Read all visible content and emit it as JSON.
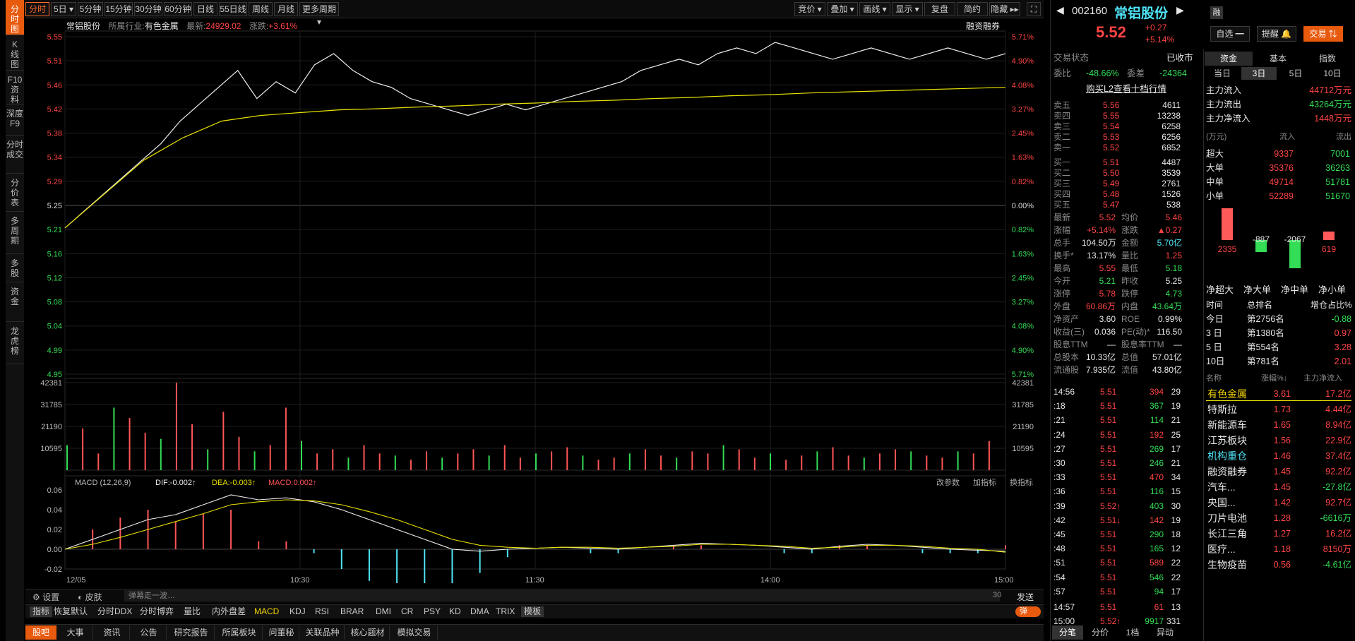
{
  "left_tabs": [
    "分\n时\n图",
    "K\n线\n图",
    "F10\n资\n料",
    "深度\nF9",
    "分时\n成交",
    "分\n价\n表",
    "多\n周\n期",
    "多\n股",
    "资\n金",
    "龙\n虎\n榜"
  ],
  "top_tabs": [
    "分时",
    "5日",
    "5分钟",
    "15分钟",
    "30分钟",
    "60分钟",
    "日线",
    "55日线",
    "周线",
    "月线",
    "更多周期"
  ],
  "top_tools": [
    "竞价",
    "叠加",
    "画线",
    "显示",
    "复盘",
    "简约",
    "隐藏"
  ],
  "chart_header": {
    "name": "常铝股份",
    "industry_label": "所属行业:",
    "industry": "有色金属",
    "latest_label": "最新:",
    "latest": "24929.02",
    "change_label": "涨跌:",
    "change": "+3.61%",
    "rzrq": "融资融券"
  },
  "chart_data": [
    {
      "type": "line",
      "title": "",
      "x_ticks": [
        "12/05",
        "10:30",
        "11:30",
        "14:00",
        "15:00"
      ],
      "ylim": [
        4.95,
        5.55
      ],
      "price_ticks": [
        "5.55",
        "5.51",
        "5.46",
        "5.42",
        "5.38",
        "5.34",
        "5.29",
        "5.25",
        "5.21",
        "5.16",
        "5.12",
        "5.08",
        "5.04",
        "4.99",
        "4.95"
      ],
      "pct_ticks": [
        "5.71%",
        "4.90%",
        "4.08%",
        "3.27%",
        "2.45%",
        "1.63%",
        "0.82%",
        "0.00%",
        "0.82%",
        "1.63%",
        "2.45%",
        "3.27%",
        "4.08%",
        "4.90%",
        "5.71%"
      ],
      "series": [
        {
          "values": [
            5.21,
            5.24,
            5.27,
            5.3,
            5.33,
            5.36,
            5.4,
            5.43,
            5.46,
            5.49,
            5.44,
            5.47,
            5.45,
            5.5,
            5.52,
            5.49,
            5.47,
            5.46,
            5.44,
            5.43,
            5.42,
            5.41,
            5.42,
            5.43,
            5.42,
            5.43,
            5.44,
            5.45,
            5.46,
            5.47,
            5.49,
            5.5,
            5.51,
            5.5,
            5.52,
            5.53,
            5.52,
            5.54,
            5.53,
            5.52,
            5.51,
            5.52,
            5.53,
            5.52,
            5.51,
            5.52,
            5.53,
            5.52,
            5.51,
            5.52
          ]
        },
        {
          "values": [
            5.21,
            5.27,
            5.33,
            5.37,
            5.4,
            5.41,
            5.415,
            5.42,
            5.422,
            5.425,
            5.427,
            5.43,
            5.432,
            5.435,
            5.437,
            5.44,
            5.442,
            5.445,
            5.447,
            5.45,
            5.452,
            5.454,
            5.456,
            5.458,
            5.46
          ]
        }
      ]
    },
    {
      "type": "bar",
      "title": "",
      "yticks": [
        "42381",
        "31785",
        "21190",
        "10595"
      ],
      "values": [
        12,
        20,
        8,
        30,
        25,
        18,
        15,
        42,
        22,
        10,
        28,
        16,
        9,
        12,
        30,
        14,
        8,
        10,
        6,
        12,
        8,
        7,
        5,
        9,
        6,
        8,
        10,
        7,
        12,
        6,
        8,
        9,
        11,
        7,
        5,
        6,
        8,
        10,
        7,
        6,
        9,
        8,
        12,
        10,
        6,
        8,
        5,
        7,
        9,
        11,
        7,
        6,
        8,
        10,
        9,
        7,
        6,
        9,
        8,
        14
      ]
    },
    {
      "type": "line",
      "title": "",
      "name_label": "MACD (12,26,9)",
      "dif": "DIF:-0.002",
      "dea": "DEA:-0.003",
      "macd": "MACD:0.002",
      "yticks": [
        "0.06",
        "0.04",
        "0.02",
        "0.00",
        "-0.02"
      ],
      "ylim": [
        -0.02,
        0.06
      ],
      "series": [
        {
          "values": [
            0.0,
            0.01,
            0.02,
            0.03,
            0.035,
            0.045,
            0.055,
            0.05,
            0.052,
            0.048,
            0.04,
            0.03,
            0.02,
            0.01,
            0.0,
            -0.002,
            0.0,
            0.001,
            0.002,
            0.001,
            0.0,
            0.002,
            0.004,
            0.006,
            0.005,
            0.004,
            0.002,
            0.0,
            0.003,
            0.005,
            0.004,
            0.002,
            0.0,
            -0.001,
            -0.002
          ]
        },
        {
          "values": [
            0.0,
            0.005,
            0.012,
            0.02,
            0.028,
            0.036,
            0.045,
            0.048,
            0.05,
            0.049,
            0.045,
            0.038,
            0.03,
            0.02,
            0.01,
            0.004,
            0.002,
            0.001,
            0.002,
            0.002,
            0.001,
            0.002,
            0.003,
            0.005,
            0.005,
            0.004,
            0.003,
            0.001,
            0.002,
            0.004,
            0.004,
            0.003,
            0.001,
            0.0,
            -0.003
          ]
        }
      ]
    }
  ],
  "macd_tools": [
    "改参数",
    "加指标",
    "换指标"
  ],
  "bottom": {
    "settings": "设置",
    "skin": "皮肤",
    "danmu_placeholder": "弹幕走一波…",
    "count": "30",
    "send": "发送",
    "indicators": [
      "指标",
      "恢复默认",
      "分时DDX",
      "分时博弈",
      "量比",
      "内外盘差",
      "MACD",
      "KDJ",
      "RSI",
      "BRAR",
      "DMI",
      "CR",
      "PSY",
      "KD",
      "DMA",
      "TRIX",
      "模板"
    ],
    "tabs": [
      "股吧",
      "大事",
      "资讯",
      "公告",
      "研究报告",
      "所属板块",
      "问董秘",
      "关联品种",
      "核心题材",
      "模拟交易"
    ],
    "toggle": "弹"
  },
  "quote": {
    "code": "002160",
    "name": "常铝股份",
    "badge": "融",
    "price": "5.52",
    "chg": "+0.27",
    "pct": "+5.14%",
    "btn_self": "自选",
    "btn_alert": "提醒",
    "btn_trade": "交易",
    "status_label": "交易状态",
    "status": "已收市",
    "weibi_label": "委比",
    "weibi": "-48.66%",
    "weicha_label": "委差",
    "weicha": "-24364",
    "l2": "购买L2查看十档行情",
    "asks": [
      [
        "卖五",
        "5.56",
        "4611"
      ],
      [
        "卖四",
        "5.55",
        "13238"
      ],
      [
        "卖三",
        "5.54",
        "6258"
      ],
      [
        "卖二",
        "5.53",
        "6256"
      ],
      [
        "卖一",
        "5.52",
        "6852"
      ]
    ],
    "bids": [
      [
        "买一",
        "5.51",
        "4487"
      ],
      [
        "买二",
        "5.50",
        "3539"
      ],
      [
        "买三",
        "5.49",
        "2761"
      ],
      [
        "买四",
        "5.48",
        "1526"
      ],
      [
        "买五",
        "5.47",
        "538"
      ]
    ],
    "stats": [
      [
        "最新",
        "5.52",
        "r",
        "均价",
        "5.46",
        "r"
      ],
      [
        "涨幅",
        "+5.14%",
        "r",
        "涨跌",
        "▲0.27",
        "r"
      ],
      [
        "总手",
        "104.50万",
        "w",
        "金额",
        "5.70亿",
        "c"
      ],
      [
        "换手*",
        "13.17%",
        "w",
        "量比",
        "1.25",
        "r"
      ],
      [
        "最高",
        "5.55",
        "r",
        "最低",
        "5.18",
        "g"
      ],
      [
        "今开",
        "5.21",
        "g",
        "昨收",
        "5.25",
        "w"
      ],
      [
        "涨停",
        "5.78",
        "r",
        "跌停",
        "4.73",
        "g"
      ],
      [
        "外盘",
        "60.86万",
        "r",
        "内盘",
        "43.64万",
        "g"
      ],
      [
        "净资产",
        "3.60",
        "w",
        "ROE",
        "0.99%",
        "w"
      ],
      [
        "收益(三)",
        "0.036",
        "w",
        "PE(动)*",
        "116.50",
        "w"
      ],
      [
        "股息TTM",
        "—",
        "w",
        "股息率TTM",
        "—",
        "w"
      ],
      [
        "总股本",
        "10.33亿",
        "w",
        "总值",
        "57.01亿",
        "w"
      ],
      [
        "流通股",
        "7.935亿",
        "w",
        "流值",
        "43.80亿",
        "w"
      ]
    ],
    "ticks": [
      [
        "14:56",
        "5.51",
        "394",
        "29"
      ],
      [
        ":18",
        "5.51",
        "367",
        "19"
      ],
      [
        ":21",
        "5.51",
        "114",
        "21"
      ],
      [
        ":24",
        "5.51",
        "192",
        "25"
      ],
      [
        ":27",
        "5.51",
        "269",
        "17"
      ],
      [
        ":30",
        "5.51",
        "246",
        "21"
      ],
      [
        ":33",
        "5.51",
        "470",
        "34"
      ],
      [
        ":36",
        "5.51",
        "116",
        "15"
      ],
      [
        ":39",
        "5.52↑",
        "403",
        "30"
      ],
      [
        ":42",
        "5.51↓",
        "142",
        "19"
      ],
      [
        ":45",
        "5.51",
        "290",
        "18"
      ],
      [
        ":48",
        "5.51",
        "165",
        "12"
      ],
      [
        ":51",
        "5.51",
        "589",
        "22"
      ],
      [
        ":54",
        "5.51",
        "546",
        "22"
      ],
      [
        ":57",
        "5.51",
        "94",
        "17"
      ],
      [
        "14:57",
        "5.51",
        "61",
        "13"
      ],
      [
        "15:00",
        "5.52↑",
        "9917",
        "331"
      ]
    ],
    "tick_tabs": [
      "分笔",
      "分价",
      "1档",
      "异动"
    ]
  },
  "fund": {
    "tabs": [
      "资金",
      "基本",
      "指数"
    ],
    "subtabs": [
      "当日",
      "3日",
      "5日",
      "10日"
    ],
    "flows": [
      [
        "主力流入",
        "44712万元",
        "r"
      ],
      [
        "主力流出",
        "43264万元",
        "g"
      ],
      [
        "主力净流入",
        "1448万元",
        "r"
      ]
    ],
    "head": [
      "(万元)",
      "流入",
      "流出"
    ],
    "rows": [
      [
        "超大",
        "9337",
        "7001"
      ],
      [
        "大单",
        "35376",
        "36263"
      ],
      [
        "中单",
        "49714",
        "51781"
      ],
      [
        "小单",
        "52289",
        "51670"
      ]
    ],
    "net": [
      {
        "label": "净超大",
        "value": 2335
      },
      {
        "label": "净大单",
        "value": -887
      },
      {
        "label": "净中单",
        "value": -2067
      },
      {
        "label": "净小单",
        "value": 619
      }
    ],
    "rank_head": [
      "时间",
      "总排名",
      "增仓占比%"
    ],
    "ranks": [
      [
        "今日",
        "第2756名",
        "-0.88",
        "g"
      ],
      [
        "3 日",
        "第1380名",
        "0.97",
        "r"
      ],
      [
        "5 日",
        "第554名",
        "3.28",
        "r"
      ],
      [
        "10日",
        "第781名",
        "2.01",
        "r"
      ]
    ],
    "sector_head": [
      "名称",
      "涨幅%↓",
      "主力净流入"
    ],
    "sectors": [
      [
        "有色金属",
        "3.61",
        "17.2亿",
        "r",
        "y"
      ],
      [
        "特斯拉",
        "1.73",
        "4.44亿",
        "r",
        "w"
      ],
      [
        "新能源车",
        "1.65",
        "8.94亿",
        "r",
        "w"
      ],
      [
        "江苏板块",
        "1.56",
        "22.9亿",
        "r",
        "w"
      ],
      [
        "机构重仓",
        "1.46",
        "37.4亿",
        "r",
        "c"
      ],
      [
        "融资融券",
        "1.45",
        "92.2亿",
        "r",
        "w"
      ],
      [
        "汽车...",
        "1.45",
        "-27.8亿",
        "g",
        "w"
      ],
      [
        "央国...",
        "1.42",
        "92.7亿",
        "r",
        "w"
      ],
      [
        "刀片电池",
        "1.28",
        "-6616万",
        "g",
        "w"
      ],
      [
        "长江三角",
        "1.27",
        "16.2亿",
        "r",
        "w"
      ],
      [
        "医疗...",
        "1.18",
        "8150万",
        "r",
        "w"
      ],
      [
        "生物疫苗",
        "0.56",
        "-4.61亿",
        "g",
        "w"
      ]
    ]
  }
}
